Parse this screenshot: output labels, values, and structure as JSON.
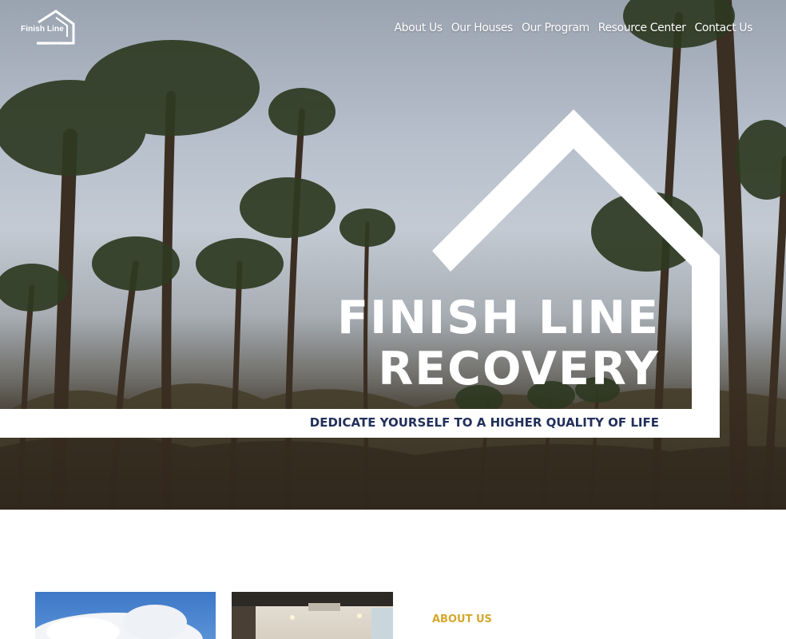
{
  "logo": {
    "name": "Finish Line",
    "subtext": "RECOVERY HOMES"
  },
  "nav": {
    "items": [
      {
        "label": "About Us"
      },
      {
        "label": "Our Houses"
      },
      {
        "label": "Our Program"
      },
      {
        "label": "Resource Center"
      },
      {
        "label": "Contact Us"
      }
    ]
  },
  "hero": {
    "title_line1": "FINISH LINE",
    "title_line2": "RECOVERY",
    "tagline": "DEDICATE YOURSELF TO A HIGHER QUALITY OF LIFE",
    "tagline_color": "#22305a"
  },
  "about": {
    "label": "ABOUT US",
    "label_color": "#d4a72c"
  }
}
